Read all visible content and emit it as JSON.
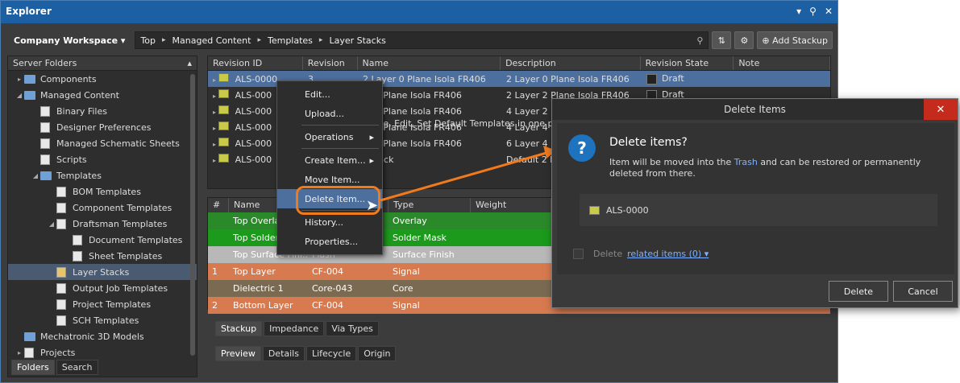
{
  "window": {
    "title": "Explorer",
    "controls": [
      "▾",
      "⚲",
      "✕"
    ]
  },
  "toolbar": {
    "workspace": "Company Workspace ▾",
    "breadcrumb": [
      "Top",
      "Managed Content",
      "Templates",
      "Layer Stacks"
    ],
    "add_label": "Add Stackup"
  },
  "left": {
    "header": "Server Folders",
    "items": [
      {
        "label": "Components",
        "indent": 1,
        "arrow": "▸",
        "icon": "folder"
      },
      {
        "label": "Managed Content",
        "indent": 1,
        "arrow": "◢",
        "icon": "folder"
      },
      {
        "label": "Binary Files",
        "indent": 2,
        "arrow": "",
        "icon": "doc"
      },
      {
        "label": "Designer Preferences",
        "indent": 2,
        "arrow": "",
        "icon": "doc"
      },
      {
        "label": "Managed Schematic Sheets",
        "indent": 2,
        "arrow": "",
        "icon": "doc"
      },
      {
        "label": "Scripts",
        "indent": 2,
        "arrow": "",
        "icon": "doc"
      },
      {
        "label": "Templates",
        "indent": 2,
        "arrow": "◢",
        "icon": "folder"
      },
      {
        "label": "BOM Templates",
        "indent": 3,
        "arrow": "",
        "icon": "doc"
      },
      {
        "label": "Component Templates",
        "indent": 3,
        "arrow": "",
        "icon": "doc"
      },
      {
        "label": "Draftsman Templates",
        "indent": 3,
        "arrow": "◢",
        "icon": "doc"
      },
      {
        "label": "Document Templates",
        "indent": 4,
        "arrow": "",
        "icon": "doc"
      },
      {
        "label": "Sheet Templates",
        "indent": 4,
        "arrow": "",
        "icon": "doc"
      },
      {
        "label": "Layer Stacks",
        "indent": 3,
        "arrow": "",
        "icon": "doc-y",
        "selected": true
      },
      {
        "label": "Output Job Templates",
        "indent": 3,
        "arrow": "",
        "icon": "doc"
      },
      {
        "label": "Project Templates",
        "indent": 3,
        "arrow": "",
        "icon": "doc"
      },
      {
        "label": "SCH Templates",
        "indent": 3,
        "arrow": "",
        "icon": "doc"
      },
      {
        "label": "Mechatronic 3D Models",
        "indent": 1,
        "arrow": "",
        "icon": "folder"
      },
      {
        "label": "Projects",
        "indent": 1,
        "arrow": "▸",
        "icon": "doc"
      }
    ],
    "tabs": [
      "Folders",
      "Search"
    ]
  },
  "grid": {
    "columns": [
      "Revision ID",
      "Revision",
      "Name",
      "Description",
      "Revision State",
      "Note"
    ],
    "rows": [
      {
        "id": "ALS-0000",
        "rev": "3",
        "name": "2 Layer 0 Plane Isola FR406",
        "desc": "2 Layer 0 Plane Isola FR406",
        "state": "Draft",
        "selected": true
      },
      {
        "id": "ALS-000",
        "rev": "",
        "name": "er 2 Plane Isola FR406",
        "desc": "2 Layer 2 Plane Isola FR406",
        "state": "Draft"
      },
      {
        "id": "ALS-000",
        "rev": "",
        "name": "er 2 Plane Isola FR406",
        "desc": "4 Layer 2 Plane Isola FR406",
        "state": ""
      },
      {
        "id": "ALS-000",
        "rev": "",
        "name": "er 4 Plane Isola FR406",
        "desc": "4 Layer 4 Plane Isola FR406",
        "state": ""
      },
      {
        "id": "ALS-000",
        "rev": "",
        "name": "er 4 Plane Isola FR406",
        "desc": "6 Layer 4 Plane Isola FR406",
        "state": ""
      },
      {
        "id": "ALS-000",
        "rev": "",
        "name": "r Stack",
        "desc": "Default 2 La",
        "state": ""
      }
    ],
    "message": "te, Edit, Set Default Templates in one pla"
  },
  "detail": {
    "columns": [
      "#",
      "Name",
      "",
      "Type",
      "Weight"
    ],
    "rows": [
      {
        "num": "",
        "name": "Top Overlay",
        "mat": "",
        "type": "Overlay",
        "weight": "",
        "bg": "#2a8a2a"
      },
      {
        "num": "",
        "name": "Top Solder",
        "mat": "",
        "type": "Solder Mask",
        "weight": "",
        "bg": "#1b9a1b"
      },
      {
        "num": "",
        "name": "Top Surface Fini...",
        "mat": "Flash",
        "type": "Surface Finish",
        "weight": "",
        "bg": "#b8b8b8"
      },
      {
        "num": "1",
        "name": "Top Layer",
        "mat": "CF-004",
        "type": "Signal",
        "weight": "",
        "bg": "#d77a4f"
      },
      {
        "num": "",
        "name": "Dielectric 1",
        "mat": "Core-043",
        "type": "Core",
        "weight": "",
        "bg": "#7a6a52"
      },
      {
        "num": "2",
        "name": "Bottom Layer",
        "mat": "CF-004",
        "type": "Signal",
        "weight": "",
        "bg": "#d77a4f"
      }
    ],
    "subtabs": [
      "Stackup",
      "Impedance",
      "Via Types"
    ],
    "bottomtabs": [
      "Preview",
      "Details",
      "Lifecycle",
      "Origin"
    ]
  },
  "menu": {
    "items": [
      {
        "label": "Edit...",
        "sub": ""
      },
      {
        "label": "Upload...",
        "sub": ""
      },
      {
        "sep": true
      },
      {
        "label": "Operations",
        "sub": "▸"
      },
      {
        "sep": true
      },
      {
        "label": "Create Item...",
        "sub": "▸"
      },
      {
        "label": "Move Item...",
        "sub": ""
      },
      {
        "label": "Delete Item...",
        "sub": "",
        "hl": true
      },
      {
        "sep": true
      },
      {
        "label": "History...",
        "sub": ""
      },
      {
        "label": "Properties...",
        "sub": ""
      }
    ]
  },
  "dialog": {
    "title": "Delete Items",
    "heading": "Delete items?",
    "text_before": "Item will be moved into the ",
    "trash_link": "Trash",
    "text_after": " and can be restored or permanently deleted from there.",
    "item": "ALS-0000",
    "rel_prefix": "Delete",
    "rel_link": "related items (0) ▾",
    "delete_btn": "Delete",
    "cancel_btn": "Cancel"
  },
  "accent": "#f07a1c"
}
